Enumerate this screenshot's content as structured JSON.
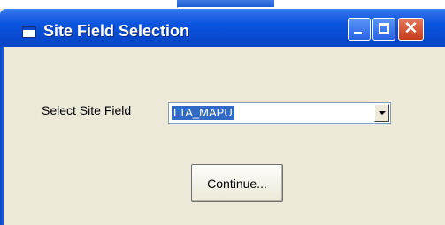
{
  "window": {
    "title": "Site Field Selection",
    "controls": {
      "minimize": "minimize-icon",
      "maximize": "maximize-icon",
      "close": "close-icon",
      "close_glyph": "✕"
    }
  },
  "form": {
    "site_field_label": "Select Site Field",
    "site_field_value": "LTA_MAPU",
    "continue_label": "Continue..."
  },
  "colors": {
    "titlebar": "#0a55e0",
    "selection": "#316ac5",
    "dialog_bg": "#ece9d8",
    "close_button": "#c63b1c"
  }
}
